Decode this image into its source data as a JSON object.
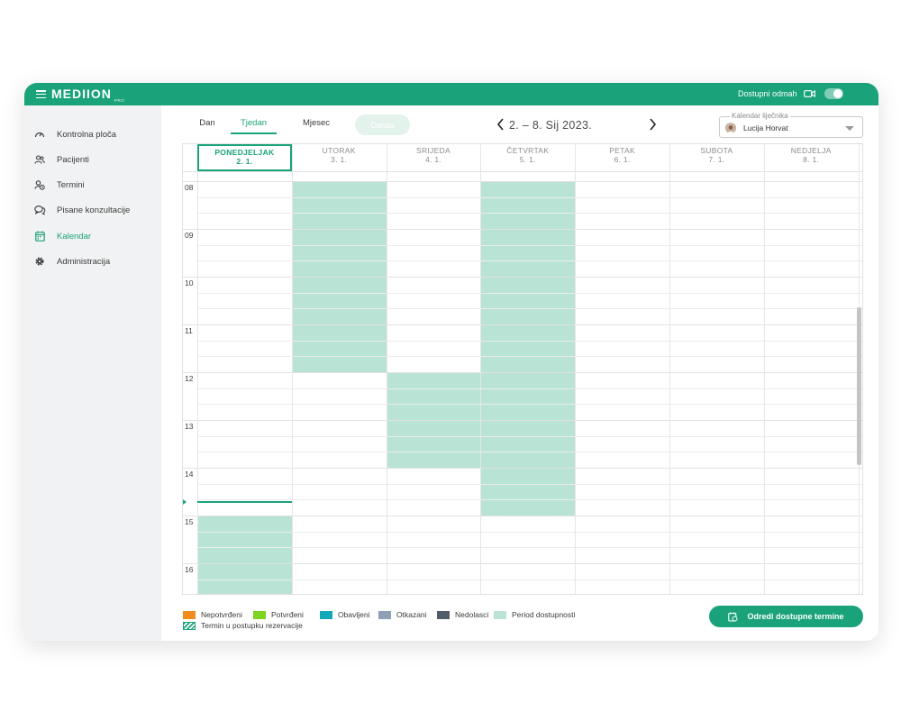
{
  "app": {
    "logo": "MEDIION",
    "logo_sub": "PRO"
  },
  "topbar": {
    "availability_label": "Dostupni odmah",
    "availability_on": true
  },
  "sidebar": {
    "items": [
      {
        "label": "Kontrolna ploča",
        "icon": "gauge-icon",
        "active": false
      },
      {
        "label": "Pacijenti",
        "icon": "users-icon",
        "active": false
      },
      {
        "label": "Termini",
        "icon": "appointment-icon",
        "active": false
      },
      {
        "label": "Pisane konzultacije",
        "icon": "chat-icon",
        "active": false
      },
      {
        "label": "Kalendar",
        "icon": "calendar-icon",
        "active": true
      },
      {
        "label": "Administracija",
        "icon": "gear-icon",
        "active": false
      }
    ]
  },
  "view_tabs": [
    {
      "label": "Dan",
      "active": false
    },
    {
      "label": "Tjedan",
      "active": true
    },
    {
      "label": "Mjesec",
      "active": false
    }
  ],
  "today_button": "Danas",
  "date_range": "2. – 8. Sij 2023.",
  "doctor_select": {
    "legend": "Kalendar liječnika",
    "value": "Lucija Horvat"
  },
  "calendar": {
    "days": [
      {
        "name": "Ponedjeljak",
        "date": "2. 1.",
        "today": true
      },
      {
        "name": "Utorak",
        "date": "3. 1.",
        "today": false
      },
      {
        "name": "Srijeda",
        "date": "4. 1.",
        "today": false
      },
      {
        "name": "Četvrtak",
        "date": "5. 1.",
        "today": false
      },
      {
        "name": "Petak",
        "date": "6. 1.",
        "today": false
      },
      {
        "name": "Subota",
        "date": "7. 1.",
        "today": false
      },
      {
        "name": "Nedjelja",
        "date": "8. 1.",
        "today": false
      }
    ],
    "hours": [
      "08",
      "09",
      "10",
      "11",
      "12",
      "13",
      "14",
      "15",
      "16"
    ],
    "availability": [
      {
        "day": 0,
        "from": 15,
        "to": 16.75
      },
      {
        "day": 1,
        "from": 8,
        "to": 12
      },
      {
        "day": 2,
        "from": 12,
        "to": 14
      },
      {
        "day": 3,
        "from": 8,
        "to": 15
      }
    ],
    "now_marker": {
      "day": 0,
      "time": 14.7
    }
  },
  "legend": [
    {
      "label": "Nepotvrđeni",
      "color": "#f28c1e"
    },
    {
      "label": "Potvrđeni",
      "color": "#7ed321"
    },
    {
      "label": "Obavljeni",
      "color": "#11a8b8"
    },
    {
      "label": "Otkazani",
      "color": "#8ea0b6"
    },
    {
      "label": "Nedolasci",
      "color": "#525c68"
    },
    {
      "label": "Period dostupnosti",
      "color": "#b9e3d5"
    },
    {
      "label": "Termin u postupku rezervacije",
      "color": "hatch"
    }
  ],
  "cta_label": "Odredi dostupne termine",
  "colors": {
    "brand": "#1aa37a",
    "availability": "#b9e3d5",
    "sidebar_bg": "#f1f2f3"
  }
}
